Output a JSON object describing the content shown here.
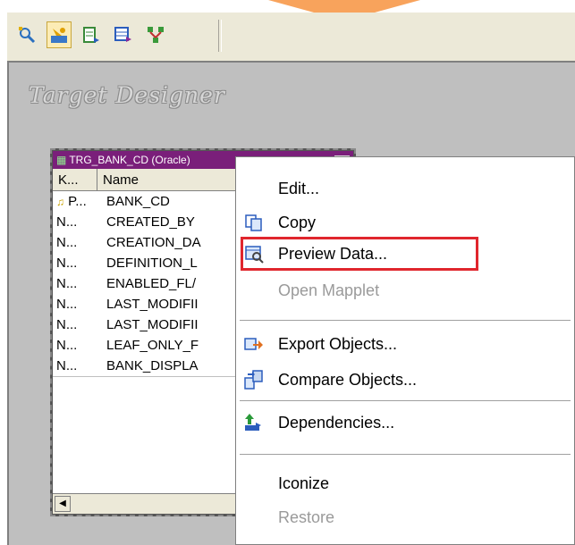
{
  "toolbar": {
    "buttons": [
      {
        "icon": "source-analyzer-icon"
      },
      {
        "icon": "target-designer-icon",
        "active": true
      },
      {
        "icon": "transformation-developer-icon"
      },
      {
        "icon": "mapplet-designer-icon"
      },
      {
        "icon": "mapping-designer-icon"
      }
    ]
  },
  "workspace": {
    "title": "Target Designer"
  },
  "table": {
    "title": "TRG_BANK_CD (Oracle)",
    "columns": {
      "key": "K...",
      "name": "Name"
    },
    "rows": [
      {
        "key": "P...",
        "name": "BANK_CD"
      },
      {
        "key": "N...",
        "name": "CREATED_BY"
      },
      {
        "key": "N...",
        "name": "CREATION_DA"
      },
      {
        "key": "N...",
        "name": "DEFINITION_L"
      },
      {
        "key": "N...",
        "name": "ENABLED_FL/"
      },
      {
        "key": "N...",
        "name": "LAST_MODIFII"
      },
      {
        "key": "N...",
        "name": "LAST_MODIFII"
      },
      {
        "key": "N...",
        "name": "LEAF_ONLY_F"
      },
      {
        "key": "N...",
        "name": "BANK_DISPLA"
      }
    ]
  },
  "menu": {
    "items": [
      {
        "label": "Edit...",
        "icon": "",
        "disabled": false
      },
      {
        "label": "Copy",
        "icon": "copy-icon",
        "disabled": false
      },
      {
        "label": "Preview Data...",
        "icon": "preview-data-icon",
        "disabled": false,
        "highlighted": true
      },
      {
        "label": "Open Mapplet",
        "icon": "",
        "disabled": true
      },
      {
        "label": "Export Objects...",
        "icon": "export-objects-icon",
        "disabled": false
      },
      {
        "label": "Compare Objects...",
        "icon": "compare-objects-icon",
        "disabled": false
      },
      {
        "label": "Dependencies...",
        "icon": "dependencies-icon",
        "disabled": false
      },
      {
        "label": "Iconize",
        "icon": "",
        "disabled": false
      },
      {
        "label": "Restore",
        "icon": "",
        "disabled": true
      }
    ]
  },
  "colors": {
    "highlight_border": "#e0262d",
    "table_title_bar": "#7a1f7a",
    "workspace_bg": "#bfbfbf"
  }
}
